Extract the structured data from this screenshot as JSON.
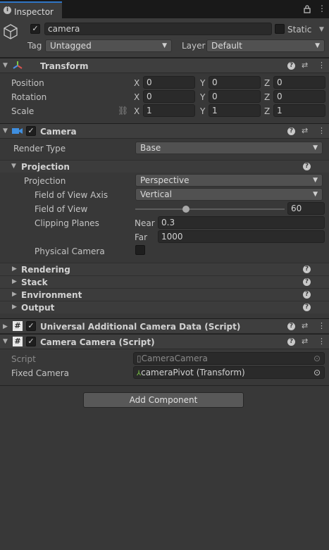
{
  "tab": {
    "title": "Inspector"
  },
  "gameobject": {
    "name": "camera",
    "static_label": "Static",
    "tag_label": "Tag",
    "tag_value": "Untagged",
    "layer_label": "Layer",
    "layer_value": "Default"
  },
  "transform": {
    "title": "Transform",
    "rows": [
      {
        "label": "Position",
        "x": "0",
        "y": "0",
        "z": "0"
      },
      {
        "label": "Rotation",
        "x": "0",
        "y": "0",
        "z": "0"
      },
      {
        "label": "Scale",
        "x": "1",
        "y": "1",
        "z": "1"
      }
    ],
    "axis": {
      "x": "X",
      "y": "Y",
      "z": "Z"
    }
  },
  "camera": {
    "title": "Camera",
    "render_type_label": "Render Type",
    "render_type_value": "Base",
    "projection_section": "Projection",
    "projection_label": "Projection",
    "projection_value": "Perspective",
    "fov_axis_label": "Field of View Axis",
    "fov_axis_value": "Vertical",
    "fov_label": "Field of View",
    "fov_value": "60",
    "fov_slider_fraction": 0.34,
    "clipping_label": "Clipping Planes",
    "near_label": "Near",
    "near_value": "0.3",
    "far_label": "Far",
    "far_value": "1000",
    "physical_label": "Physical Camera",
    "sections": [
      "Rendering",
      "Stack",
      "Environment",
      "Output"
    ]
  },
  "uacd": {
    "title": "Universal Additional Camera Data (Script)"
  },
  "camcam": {
    "title": "Camera Camera (Script)",
    "script_label": "Script",
    "script_value": "CameraCamera",
    "fixed_label": "Fixed Camera",
    "fixed_value": "cameraPivot (Transform)"
  },
  "add_component": "Add Component",
  "colors": {
    "accent": "#2f76c7",
    "background": "#383838",
    "header": "#3e3e3e"
  },
  "icons": [
    "info-icon",
    "lock-icon",
    "menu-icon",
    "cube-icon",
    "transform-icon",
    "camera-icon",
    "script-icon",
    "help-icon",
    "presets-icon",
    "kebab-icon"
  ]
}
